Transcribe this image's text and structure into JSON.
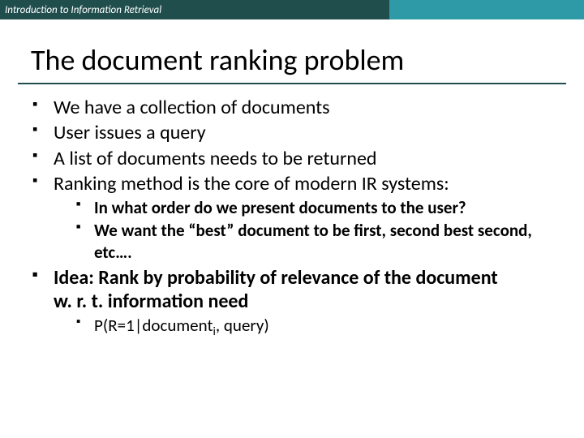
{
  "header": {
    "text": "Introduction to Information Retrieval"
  },
  "title": "The document ranking problem",
  "bullets": {
    "b1": "We have a collection of documents",
    "b2": "User issues a query",
    "b3": "A list of documents needs to be returned",
    "b4": "Ranking method is the core of modern IR systems:",
    "b4_sub1": "In what order do we present documents to the user?",
    "b4_sub2": "We want the “best” document to be first, second best second, etc….",
    "b5_prefix": "Idea:",
    "b5_rest": " Rank by probability of relevance of the document w. r. t. information need",
    "b5_sub1_a": "P(R=1|document",
    "b5_sub1_i": "i",
    "b5_sub1_b": ", query)"
  }
}
